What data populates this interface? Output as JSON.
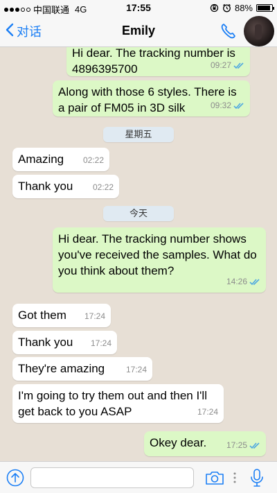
{
  "status_bar": {
    "carrier": "中国联通",
    "network": "4G",
    "time": "17:55",
    "battery": "88%",
    "battery_level": 0.88
  },
  "header": {
    "back_label": "对话",
    "contact_name": "Emily"
  },
  "messages": [
    {
      "dir": "out",
      "text": "Hi dear. The tracking number is 4896395700",
      "time": "09:27",
      "read": true
    },
    {
      "dir": "out",
      "text": "Along with those 6 styles. There is a pair of FM05 in 3D silk",
      "time": "09:32",
      "read": true
    },
    {
      "type": "day",
      "text": "星期五"
    },
    {
      "dir": "in",
      "text": "Amazing",
      "time": "02:22"
    },
    {
      "dir": "in",
      "text": "Thank you",
      "time": "02:22"
    },
    {
      "type": "day",
      "text": "今天"
    },
    {
      "dir": "out",
      "text": "Hi dear. The tracking number shows you've received the samples. What do you think about them?",
      "time": "14:26",
      "read": true
    },
    {
      "dir": "in",
      "text": "Got them",
      "time": "17:24"
    },
    {
      "dir": "in",
      "text": "Thank you",
      "time": "17:24"
    },
    {
      "dir": "in",
      "text": "They're amazing",
      "time": "17:24"
    },
    {
      "dir": "in",
      "text": "I'm going to try them out and then I'll get back to you ASAP",
      "time": "17:24"
    },
    {
      "dir": "out",
      "text": "Okey dear.",
      "time": "17:25",
      "read": true
    }
  ],
  "input": {
    "value": "",
    "placeholder": ""
  },
  "colors": {
    "accent": "#1a7ef5",
    "outgoing_bubble": "#dcf8c6",
    "incoming_bubble": "#ffffff",
    "read_ticks": "#4fa8e0",
    "chat_background": "#e7dfd5"
  },
  "icons": {
    "back": "chevron-left-icon",
    "call": "phone-icon",
    "upload": "upload-icon",
    "camera": "camera-icon",
    "mic": "microphone-icon"
  }
}
